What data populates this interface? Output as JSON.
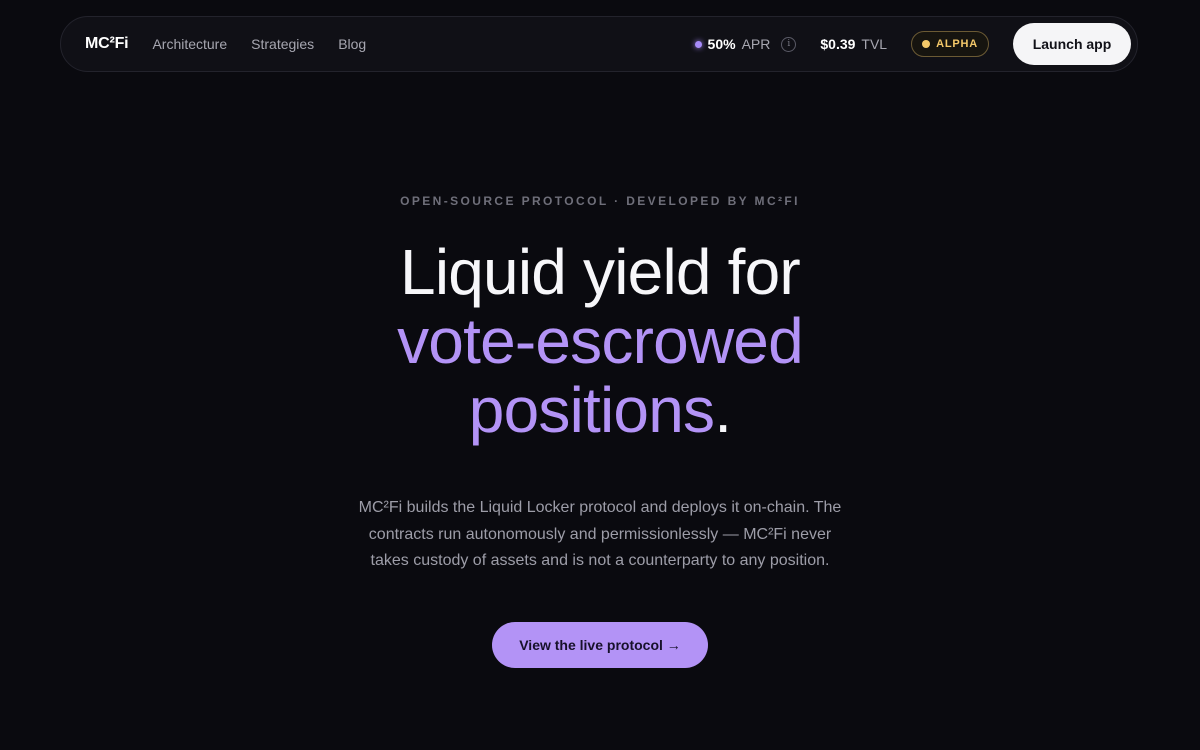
{
  "nav": {
    "logo": "MC²Fi",
    "links": [
      "Architecture",
      "Strategies",
      "Blog"
    ],
    "apr": {
      "value": "50%",
      "label": "APR",
      "info_icon": "info-icon"
    },
    "tvl": {
      "value": "$0.39",
      "label": "TVL"
    },
    "badge": "ALPHA",
    "launch_label": "Launch app"
  },
  "hero": {
    "eyebrow": "OPEN-SOURCE PROTOCOL · DEVELOPED BY MC²FI",
    "headline_line1": "Liquid yield for",
    "headline_line2": "vote-escrowed",
    "headline_line3_accent": "positions",
    "headline_line3_period": ".",
    "description": "MC²Fi builds the Liquid Locker protocol and deploys it on-chain. The contracts run autonomously and permissionlessly — MC²Fi never takes custody of assets and is not a counterparty to any position.",
    "cta_label": "View the live protocol →"
  },
  "colors": {
    "background": "#0a0a0f",
    "accent": "#b393f6",
    "badge": "#f4c869"
  }
}
